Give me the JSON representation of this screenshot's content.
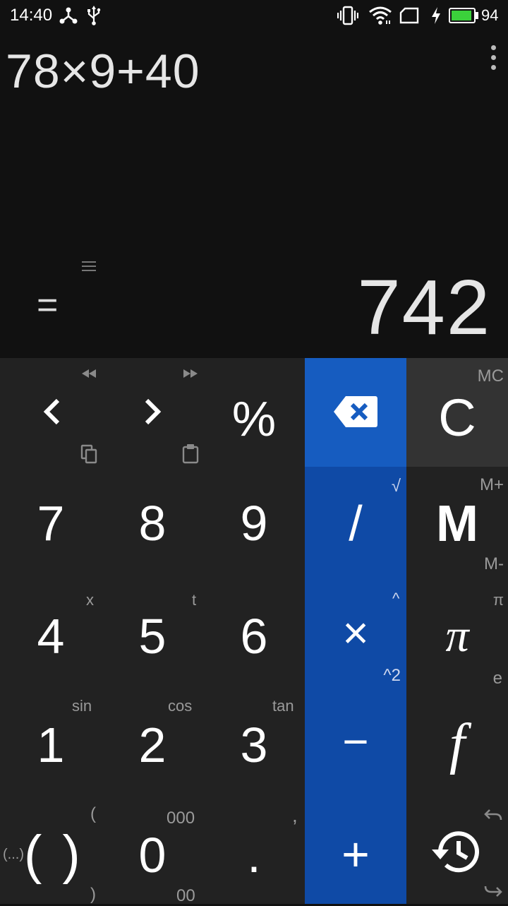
{
  "status_bar": {
    "time": "14:40",
    "battery_percent": "94",
    "battery_level": 0.94,
    "battery_color": "#3bd13b"
  },
  "display": {
    "expression": "78×9+40",
    "equals": "=",
    "result": "742"
  },
  "keys": {
    "left": {
      "main": "<",
      "sub_top": "◂◂",
      "sub_bottom_icon": "copy-icon"
    },
    "right": {
      "main": ">",
      "sub_top": "▸▸",
      "sub_bottom_icon": "paste-icon"
    },
    "percent": {
      "main": "%"
    },
    "backspace": {
      "icon": "backspace-icon"
    },
    "clear": {
      "main": "C",
      "sub": "MC"
    },
    "seven": {
      "main": "7"
    },
    "eight": {
      "main": "8"
    },
    "nine": {
      "main": "9"
    },
    "divide": {
      "main": "/",
      "sub": "√"
    },
    "memory": {
      "main": "M",
      "sub_top": "M+",
      "sub_bottom": "M-"
    },
    "four": {
      "main": "4",
      "sub": "x"
    },
    "five": {
      "main": "5",
      "sub": "t"
    },
    "six": {
      "main": "6"
    },
    "multiply": {
      "main": "×",
      "sub_top": "^",
      "sub_bottom": "^2"
    },
    "pi": {
      "main": "π",
      "sub_top": "π",
      "sub_bottom": "e"
    },
    "one": {
      "main": "1",
      "sub": "sin"
    },
    "two": {
      "main": "2",
      "sub": "cos"
    },
    "three": {
      "main": "3",
      "sub": "tan"
    },
    "minus": {
      "main": "−"
    },
    "function": {
      "main": "f"
    },
    "parens": {
      "main": "( )",
      "sub_top": "(",
      "sub_bottom": ")",
      "sub_left": "(...)"
    },
    "zero": {
      "main": "0",
      "sub_top": "000",
      "sub_bottom": "00"
    },
    "dot": {
      "main": ".",
      "sub": ","
    },
    "plus": {
      "main": "+"
    },
    "history": {
      "icon": "history-icon",
      "sub_top_icon": "undo-icon",
      "sub_bottom_icon": "redo-icon"
    }
  }
}
